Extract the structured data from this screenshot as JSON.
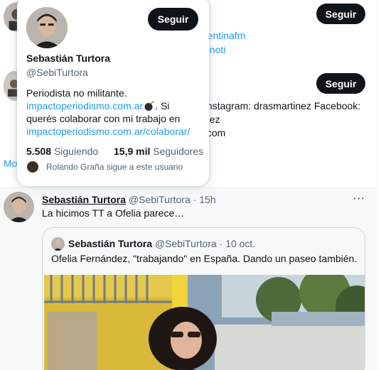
{
  "background": {
    "follow_label_1": "Seguir",
    "follow_label_2": "Seguir",
    "line_1": "rentinafm",
    "line_2": "enoti",
    "line_3": "Instagram: drasmartinez Facebook:",
    "line_4": "nez",
    "line_5": ".com",
    "more_text": "Mo"
  },
  "hover_card": {
    "follow_label": "Seguir",
    "name": "Sebastián Turtora",
    "handle": "@SebiTurtora",
    "bio_line_1": "Periodista no militante.",
    "bio_link_1": "impactoperiodismo.com.ar",
    "bio_after_link": ". Si",
    "bio_line_3": "querés colaborar con mi trabajo en",
    "bio_link_2": "impactoperiodismo.com.ar/colaborar/",
    "following_count": "5.508",
    "following_label": "Siguiendo",
    "followers_count": "15,9 mil",
    "followers_label": "Seguidores",
    "mutual_text": "Rolando Graña sigue a este usuario",
    "bomb_icon": "bomb-icon"
  },
  "tweet": {
    "name": "Sebastián Turtora",
    "handle": "@SebiTurtora",
    "separator": "·",
    "time": "15h",
    "more": "···",
    "text": "La hicimos TT a Ofelia parece…",
    "quote": {
      "name": "Sebastián Turtora",
      "handle": "@SebiTurtora",
      "separator": "·",
      "date": "10 oct.",
      "text": "Ofelia Fernández, \"trabajando\" en España. Dando un paseo también."
    }
  },
  "colors": {
    "accent": "#1d9bf0",
    "button": "#0f1419",
    "muted": "#536471"
  }
}
